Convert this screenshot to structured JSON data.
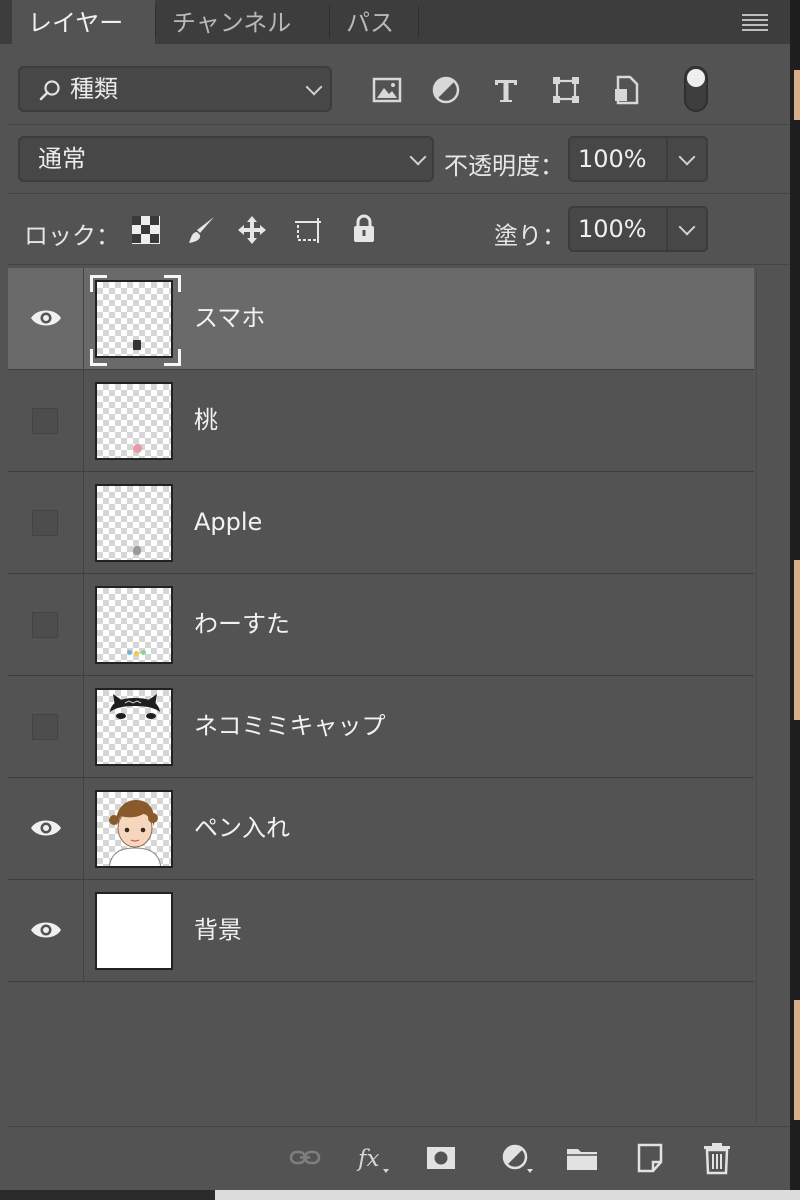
{
  "tabs": [
    {
      "label": "レイヤー",
      "active": true
    },
    {
      "label": "チャンネル",
      "active": false
    },
    {
      "label": "パス",
      "active": false
    }
  ],
  "filter": {
    "label": "種類",
    "icons": [
      "image-filter-icon",
      "adjustment-filter-icon",
      "type-filter-icon",
      "shape-filter-icon",
      "smart-object-filter-icon"
    ]
  },
  "blend": {
    "mode": "通常",
    "opacity_label": "不透明度：",
    "opacity_value": "100%"
  },
  "lock": {
    "label": "ロック：",
    "fill_label": "塗り：",
    "fill_value": "100%"
  },
  "layers": [
    {
      "name": "スマホ",
      "visible": true,
      "selected": true,
      "thumb": "smartphone"
    },
    {
      "name": "桃",
      "visible": false,
      "selected": false,
      "thumb": "peach"
    },
    {
      "name": "Apple",
      "visible": false,
      "selected": false,
      "thumb": "apple"
    },
    {
      "name": "わーすた",
      "visible": false,
      "selected": false,
      "thumb": "wasuta"
    },
    {
      "name": "ネコミミキャップ",
      "visible": false,
      "selected": false,
      "thumb": "cap"
    },
    {
      "name": "ペン入れ",
      "visible": true,
      "selected": false,
      "thumb": "character"
    },
    {
      "name": "背景",
      "visible": true,
      "selected": false,
      "thumb": "white"
    }
  ],
  "footer_icons": [
    "link-layers-icon",
    "layer-style-fx-icon",
    "add-mask-icon",
    "new-adjustment-icon",
    "new-group-icon",
    "new-layer-icon",
    "delete-layer-icon"
  ],
  "colors": {
    "panel": "#535353",
    "tabbar": "#3d3d3d",
    "selected_row": "#6a6a6a",
    "text": "#e6e6e6"
  }
}
